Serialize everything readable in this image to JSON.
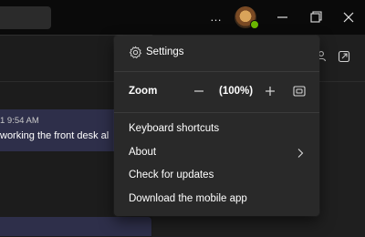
{
  "chat": {
    "message_time": "1 9:54 AM",
    "message_text": "working the front desk al"
  },
  "titlebar": {
    "more_label": "…",
    "presence": "available",
    "presence_color": "#6bb700"
  },
  "menu": {
    "settings": {
      "label": "Settings",
      "icon": "gear-icon"
    },
    "zoom": {
      "label": "Zoom",
      "value": "(100%)",
      "minus_icon": "minus-icon",
      "plus_icon": "plus-icon",
      "reset_icon": "fit-screen-icon"
    },
    "items": [
      {
        "label": "Keyboard shortcuts"
      },
      {
        "label": "About",
        "icon": "chevron-right-icon"
      },
      {
        "label": "Check for updates"
      },
      {
        "label": "Download the mobile app"
      }
    ]
  },
  "colors": {
    "titlebar_bg": "#0a0a0a",
    "app_bg": "#1f1f1f",
    "menu_bg": "#292929",
    "bubble_bg": "#2e2f4a"
  }
}
